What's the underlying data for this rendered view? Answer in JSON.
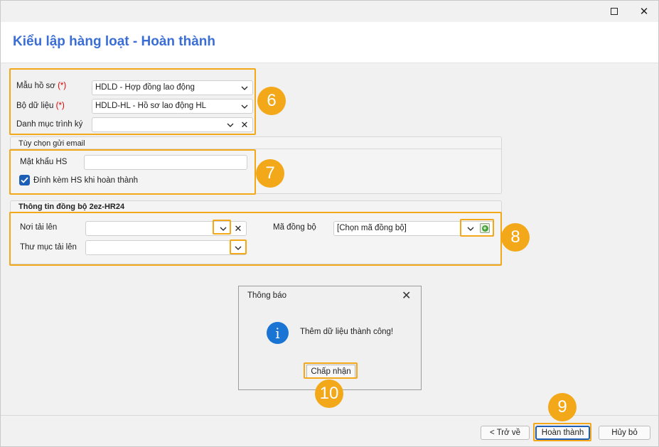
{
  "page_title": "Kiểu lập hàng loạt - Hoàn thành",
  "window_controls": {
    "maximize_icon": "maximize-icon",
    "close_icon": "close-icon",
    "close_glyph": "✕"
  },
  "form": {
    "template_label": "Mẫu hồ sơ",
    "template_required": "(*)",
    "template_value": "HDLD - Hợp đồng lao động",
    "dataset_label": "Bộ dữ liệu",
    "dataset_required": "(*)",
    "dataset_value": "HDLD-HL - Hồ sơ lao động HL",
    "signing_label": "Danh mục trình ký",
    "signing_value": ""
  },
  "email_options": {
    "title": "Tùy chọn gửi email",
    "password_label": "Mật khẩu HS",
    "password_value": "",
    "attach_label": "Đính kèm HS khi hoàn thành",
    "attach_checked": true
  },
  "sync": {
    "title": "Thông tin đồng bộ 2ez-HR24",
    "upload_location_label": "Nơi tải lên",
    "upload_location_value": "",
    "upload_folder_label": "Thư mục tải lên",
    "upload_folder_value": "",
    "sync_code_label": "Mã đồng bộ",
    "sync_code_value": "[Chọn mã đồng bộ]"
  },
  "dialog": {
    "title": "Thông báo",
    "message": "Thêm dữ liệu thành công!",
    "ok_label": "Chấp nhận",
    "icon": "info-icon",
    "info_glyph": "i"
  },
  "footer": {
    "back_label": "< Trở về",
    "finish_label": "Hoàn thành",
    "cancel_label": "Hủy bỏ"
  },
  "callouts": {
    "form": "6",
    "email": "7",
    "sync": "8",
    "finish": "9",
    "dialog_ok": "10"
  },
  "accent_color": "#f2a818",
  "title_color": "#3a6ed6",
  "glyphs": {
    "clear": "✕",
    "plus": "+"
  }
}
